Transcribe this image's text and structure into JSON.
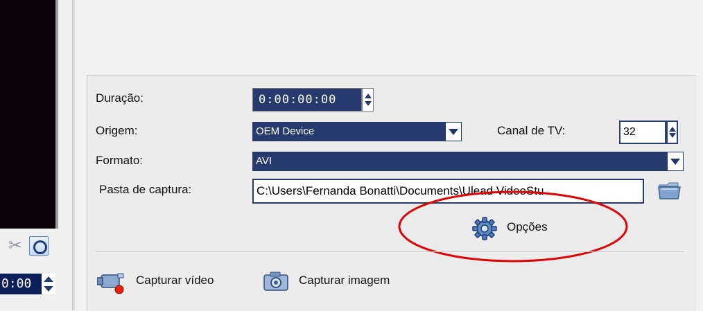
{
  "left": {
    "timecode": "0:00"
  },
  "capture": {
    "duration_label": "Duração:",
    "duration_value": "0:00:00:00",
    "source_label": "Origem:",
    "source_value": "OEM Device",
    "tv_channel_label": "Canal de TV:",
    "tv_channel_value": "32",
    "format_label": "Formato:",
    "format_value": "AVI",
    "folder_label": "Pasta de captura:",
    "folder_value": "C:\\Users\\Fernanda Bonatti\\Documents\\Ulead VideoStu",
    "options_label": "Opções",
    "capture_video_label": "Capturar vídeo",
    "capture_image_label": "Capturar imagem"
  },
  "colors": {
    "accent_navy": "#263a6e",
    "highlight_red": "#e00000"
  },
  "icons": [
    "scissors-icon",
    "fullscreen-icon",
    "gear-icon",
    "folder-icon",
    "video-camera-icon",
    "photo-camera-icon",
    "spinner-arrows-icon",
    "dropdown-arrow-icon"
  ]
}
